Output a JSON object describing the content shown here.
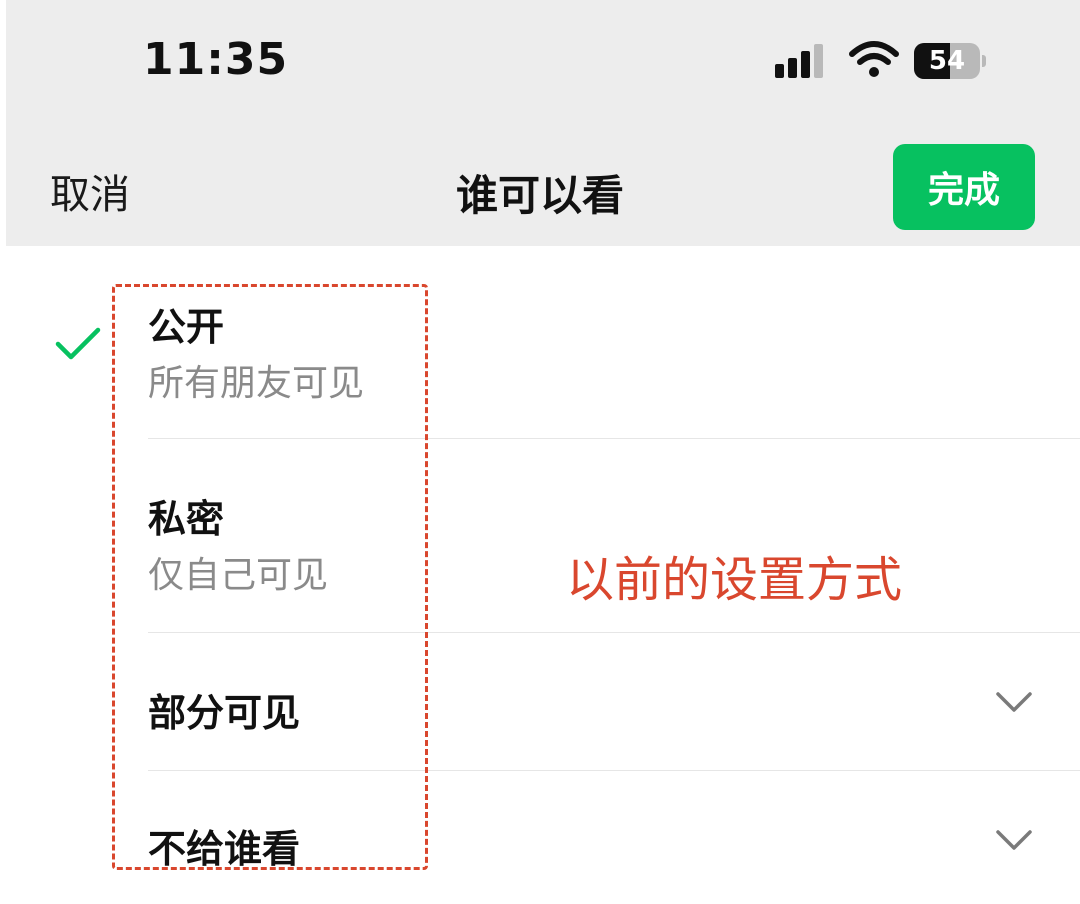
{
  "status_bar": {
    "time": "11:35",
    "battery_level": "54",
    "battery_fraction": 0.54
  },
  "nav": {
    "cancel_label": "取消",
    "title": "谁可以看",
    "done_label": "完成"
  },
  "options": [
    {
      "label": "公开",
      "subtitle": "所有朋友可见",
      "selected": true
    },
    {
      "label": "私密",
      "subtitle": "仅自己可见",
      "selected": false
    },
    {
      "label": "部分可见",
      "expandable": true
    },
    {
      "label": "不给谁看",
      "expandable": true
    }
  ],
  "annotation": {
    "text": "以前的设置方式"
  },
  "colors": {
    "accent": "#07c160",
    "annotation": "#d9472e",
    "header_bg": "#ededed"
  },
  "icons": [
    "signal-icon",
    "wifi-icon",
    "battery-icon",
    "check-icon",
    "chevron-down-icon"
  ]
}
